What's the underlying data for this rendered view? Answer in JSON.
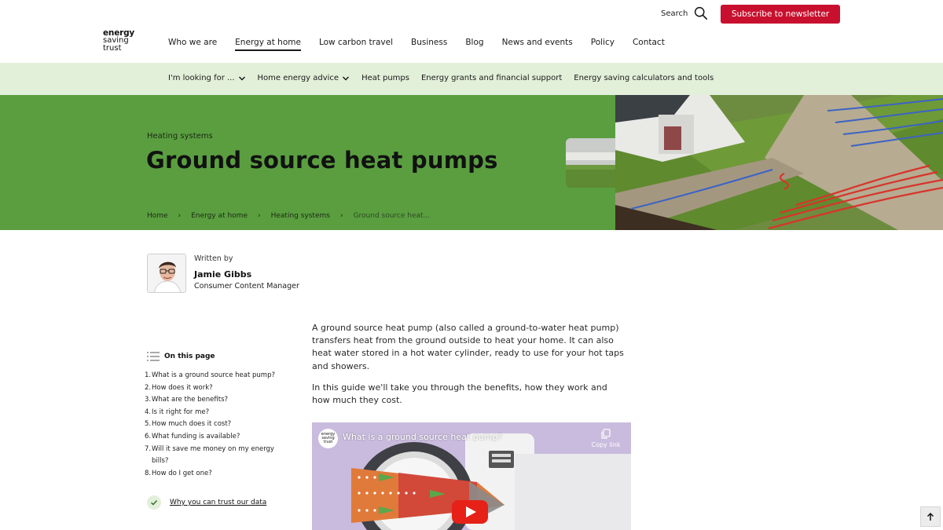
{
  "logo": {
    "line1": "energy",
    "line2": "saving",
    "line3": "trust"
  },
  "header": {
    "search_label": "Search",
    "subscribe_label": "Subscribe to newsletter",
    "nav": [
      "Who we are",
      "Energy at home",
      "Low carbon travel",
      "Business",
      "Blog",
      "News and events",
      "Policy",
      "Contact"
    ],
    "active_nav": "Energy at home"
  },
  "subnav": {
    "items": [
      "I'm looking for ...",
      "Home energy advice",
      "Heat pumps",
      "Energy grants and financial support",
      "Energy saving calculators and tools"
    ]
  },
  "hero": {
    "eyebrow": "Heating systems",
    "title": "Ground source heat pumps",
    "breadcrumbs": [
      "Home",
      "Energy at home",
      "Heating systems",
      "Ground source heat..."
    ],
    "breadcrumb_separator": "›"
  },
  "author": {
    "written_by": "Written by",
    "name": "Jamie Gibbs",
    "role": "Consumer Content Manager"
  },
  "toc": {
    "heading": "On this page",
    "items": [
      {
        "num": "1.",
        "label": "What is a ground source heat pump?"
      },
      {
        "num": "2.",
        "label": "How does it work?"
      },
      {
        "num": "3.",
        "label": "What are the benefits?"
      },
      {
        "num": "4.",
        "label": "Is it right for me?"
      },
      {
        "num": "5.",
        "label": "How much does it cost?"
      },
      {
        "num": "6.",
        "label": "What funding is available?"
      },
      {
        "num": "7.",
        "label": "Will it save me money on my energy bills?"
      },
      {
        "num": "8.",
        "label": "How do I get one?"
      }
    ],
    "trust_link": "Why you can trust our data"
  },
  "body": {
    "para1": "A ground source heat pump (also called a ground-to-water heat pump) transfers heat from the ground outside to heat your home. It can also heat water stored in a hot water cylinder, ready to use for your hot taps and showers.",
    "para2": "In this guide we'll take you through the benefits, how they work and how much they cost."
  },
  "video": {
    "title": "What is a ground source heat pump?",
    "copy_link": "Copy link",
    "logo_l1": "energy",
    "logo_l2": "saving",
    "logo_l3": "trust"
  },
  "colors": {
    "brand_red": "#c8102e",
    "hero_green": "#5a9e40",
    "subnav_bg": "#e2efd9"
  },
  "icons": [
    "search-icon",
    "chevron-down-icon",
    "list-icon",
    "check-icon",
    "copy-icon",
    "play-icon",
    "arrow-up-icon"
  ]
}
